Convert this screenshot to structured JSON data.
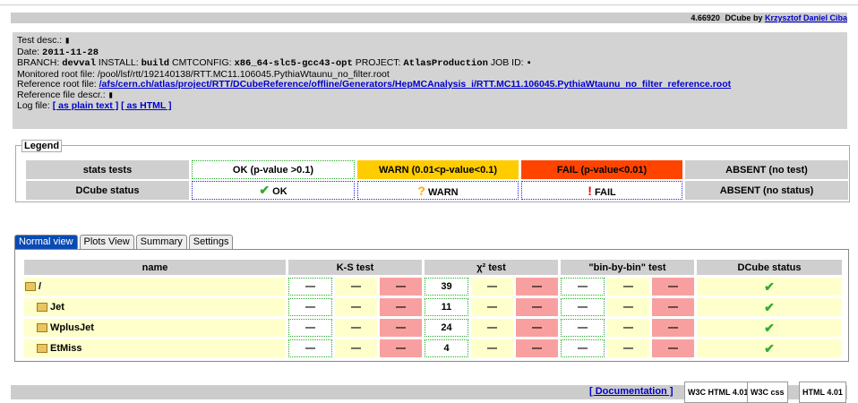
{
  "header": {
    "version": "4.66920",
    "dcube_by": "DCube by",
    "author": "Krzysztof Daniel Ciba"
  },
  "info": {
    "test_desc_label": "Test desc.:",
    "test_desc": "▮",
    "date_label": "Date:",
    "date": "2011-11-28",
    "branch_label": "BRANCH:",
    "branch": "devval",
    "install_label": "INSTALL:",
    "install": "build",
    "cmtconfig_label": "CMTCONFIG:",
    "cmtconfig": "x86_64-slc5-gcc43-opt",
    "project_label": "PROJECT:",
    "project": "AtlasProduction",
    "jobid_label": "JOB ID:",
    "jobid": "▪",
    "monitored_label": "Monitored root file:",
    "monitored": "/pool/lsf/rtt/192140138/RTT.MC11.106045.PythiaWtaunu_no_filter.root",
    "reference_label": "Reference root file:",
    "reference": "/afs/cern.ch/atlas/project/RTT/DCubeReference/offline/Generators/HepMCAnalysis_i/RTT.MC11.106045.PythiaWtaunu_no_filter_reference.root",
    "ref_desc_label": "Reference file descr.:",
    "ref_desc": "▮",
    "log_label": "Log file:",
    "log_plain": "[ as plain text ]",
    "log_html": "[ as HTML ]"
  },
  "legend": {
    "title": "Legend",
    "row1": {
      "label": "stats tests",
      "ok": "OK (p-value >0.1)",
      "warn": "WARN (0.01<p-value<0.1)",
      "fail": "FAIL (p-value<0.01)",
      "absent": "ABSENT (no test)"
    },
    "row2": {
      "label": "DCube status",
      "ok": "OK",
      "warn": "WARN",
      "fail": "FAIL",
      "absent": "ABSENT (no status)"
    }
  },
  "tabs": [
    "Normal view",
    "Plots View",
    "Summary",
    "Settings"
  ],
  "table": {
    "headers": {
      "name": "name",
      "ks": "K-S test",
      "chi2": "χ² test",
      "bbb": "\"bin-by-bin\" test",
      "status": "DCube status"
    },
    "rows": [
      {
        "name": "/",
        "chi2": "39"
      },
      {
        "name": "Jet",
        "chi2": "11"
      },
      {
        "name": "WplusJet",
        "chi2": "24"
      },
      {
        "name": "EtMiss",
        "chi2": "4"
      }
    ],
    "dash": "—",
    "check": "✔"
  },
  "footer": {
    "documentation": "[ Documentation ]",
    "badge1": "W3C HTML 4.01",
    "badge2": "W3C css",
    "badge3": "HTML 4.01"
  }
}
